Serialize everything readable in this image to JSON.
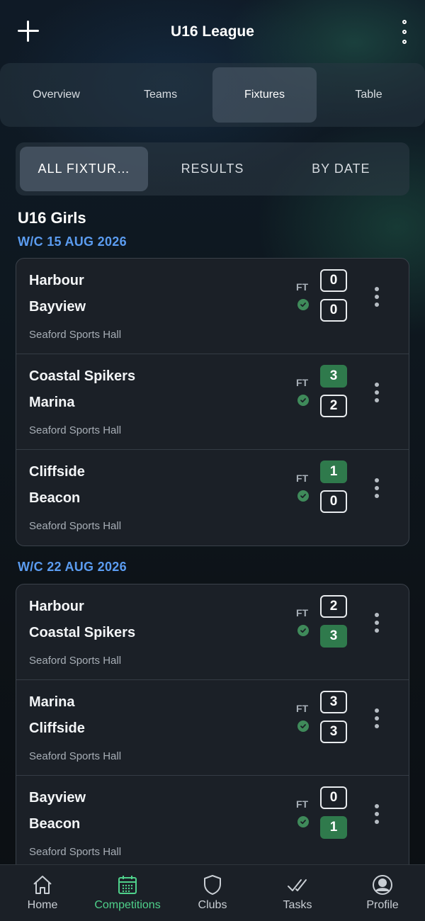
{
  "header": {
    "title": "U16 League"
  },
  "tabs": [
    {
      "label": "Overview"
    },
    {
      "label": "Teams"
    },
    {
      "label": "Fixtures",
      "active": true
    },
    {
      "label": "Table"
    }
  ],
  "filters": [
    {
      "label": "ALL FIXTUR…",
      "active": true
    },
    {
      "label": "RESULTS"
    },
    {
      "label": "BY DATE"
    }
  ],
  "section_title": "U16 Girls",
  "weeks": [
    {
      "label": "W/C 15 AUG 2026",
      "fixtures": [
        {
          "home": "Harbour",
          "away": "Bayview",
          "home_score": "0",
          "away_score": "0",
          "status": "FT",
          "venue": "Seaford Sports Hall",
          "winner": "none"
        },
        {
          "home": "Coastal Spikers",
          "away": "Marina",
          "home_score": "3",
          "away_score": "2",
          "status": "FT",
          "venue": "Seaford Sports Hall",
          "winner": "home"
        },
        {
          "home": "Cliffside",
          "away": "Beacon",
          "home_score": "1",
          "away_score": "0",
          "status": "FT",
          "venue": "Seaford Sports Hall",
          "winner": "home"
        }
      ]
    },
    {
      "label": "W/C 22 AUG 2026",
      "fixtures": [
        {
          "home": "Harbour",
          "away": "Coastal Spikers",
          "home_score": "2",
          "away_score": "3",
          "status": "FT",
          "venue": "Seaford Sports Hall",
          "winner": "away"
        },
        {
          "home": "Marina",
          "away": "Cliffside",
          "home_score": "3",
          "away_score": "3",
          "status": "FT",
          "venue": "Seaford Sports Hall",
          "winner": "none"
        },
        {
          "home": "Bayview",
          "away": "Beacon",
          "home_score": "0",
          "away_score": "1",
          "status": "FT",
          "venue": "Seaford Sports Hall",
          "winner": "away"
        }
      ]
    }
  ],
  "bottom_nav": [
    {
      "label": "Home",
      "icon": "home-icon"
    },
    {
      "label": "Competitions",
      "icon": "calendar-icon",
      "active": true
    },
    {
      "label": "Clubs",
      "icon": "shield-icon"
    },
    {
      "label": "Tasks",
      "icon": "checks-icon"
    },
    {
      "label": "Profile",
      "icon": "user-circle-icon"
    }
  ],
  "colors": {
    "accent": "#4fd18b",
    "week_label": "#5b9cf0",
    "win_badge": "#2f7a4c",
    "card_bg": "#1b2027"
  }
}
